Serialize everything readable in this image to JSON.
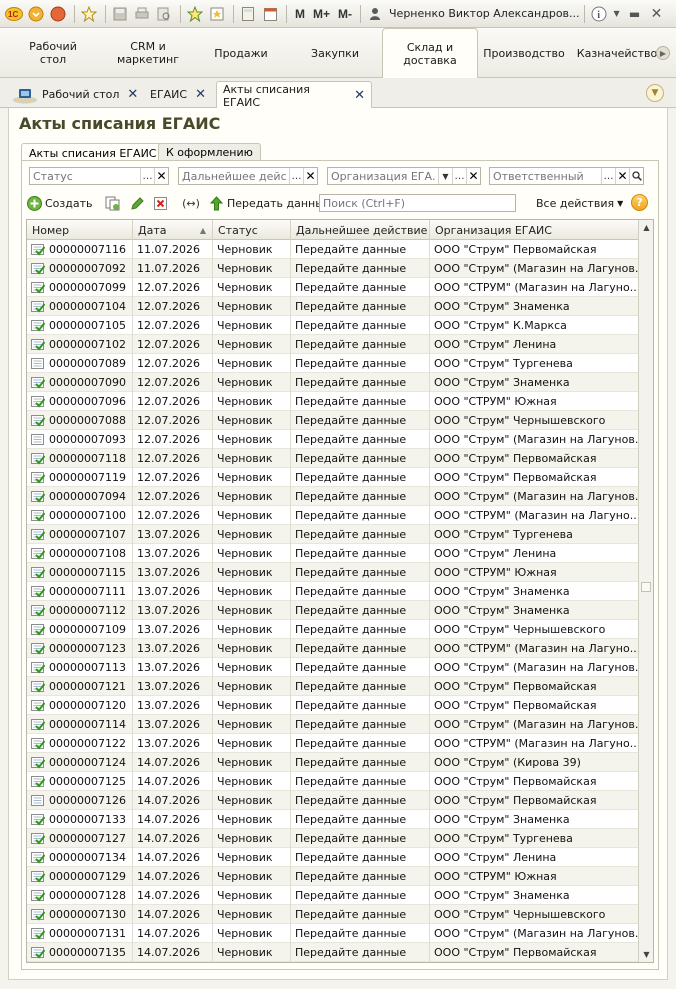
{
  "toolbar": {
    "user": "Черненко Виктор Александров...",
    "m": "M",
    "m_plus": "M+",
    "m_minus": "M-"
  },
  "sections": [
    "Рабочий\nстол",
    "CRM и\nмаркетинг",
    "Продажи",
    "Закупки",
    "Склад и\nдоставка",
    "Производство",
    "Казначейство"
  ],
  "window_tabs": [
    "Рабочий стол",
    "ЕГАИС",
    "Акты списания ЕГАИС"
  ],
  "form": {
    "title": "Акты списания ЕГАИС",
    "tabs": [
      "Акты списания ЕГАИС",
      "К оформлению"
    ]
  },
  "filters": {
    "status": "Статус",
    "next_action": "Дальнейшее дейст...",
    "organization": "Организация ЕГА...",
    "responsible": "Ответственный"
  },
  "commands": {
    "create": "Создать",
    "transfer": "Передать данные",
    "search_placeholder": "Поиск (Ctrl+F)",
    "all_actions": "Все действия",
    "help": "?"
  },
  "table": {
    "columns": [
      "Номер",
      "Дата",
      "Статус",
      "Дальнейшее действие",
      "Организация ЕГАИС"
    ],
    "rows": [
      [
        "00000007116",
        "11.07.2026",
        "Черновик",
        "Передайте данные",
        "ООО \"Струм\" Первомайская",
        "check"
      ],
      [
        "00000007092",
        "11.07.2026",
        "Черновик",
        "Передайте данные",
        "ООО \"Струм\" (Магазин на Лагунов...",
        "check"
      ],
      [
        "00000007099",
        "12.07.2026",
        "Черновик",
        "Передайте данные",
        "ООО \"СТРУМ\" (Магазин на Лагуно...",
        "check"
      ],
      [
        "00000007104",
        "12.07.2026",
        "Черновик",
        "Передайте данные",
        "ООО \"Струм\" Знаменка",
        "check"
      ],
      [
        "00000007105",
        "12.07.2026",
        "Черновик",
        "Передайте данные",
        "ООО \"Струм\" К.Маркса",
        "check"
      ],
      [
        "00000007102",
        "12.07.2026",
        "Черновик",
        "Передайте данные",
        "ООО \"Струм\" Ленина",
        "check"
      ],
      [
        "00000007089",
        "12.07.2026",
        "Черновик",
        "Передайте данные",
        "ООО \"Струм\" Тургенева",
        "plain"
      ],
      [
        "00000007090",
        "12.07.2026",
        "Черновик",
        "Передайте данные",
        "ООО \"Струм\" Знаменка",
        "check"
      ],
      [
        "00000007096",
        "12.07.2026",
        "Черновик",
        "Передайте данные",
        "ООО \"СТРУМ\" Южная",
        "check"
      ],
      [
        "00000007088",
        "12.07.2026",
        "Черновик",
        "Передайте данные",
        "ООО \"Струм\" Чернышевского",
        "check"
      ],
      [
        "00000007093",
        "12.07.2026",
        "Черновик",
        "Передайте данные",
        "ООО \"Струм\" (Магазин на Лагунов...",
        "plain"
      ],
      [
        "00000007118",
        "12.07.2026",
        "Черновик",
        "Передайте данные",
        "ООО \"Струм\" Первомайская",
        "check"
      ],
      [
        "00000007119",
        "12.07.2026",
        "Черновик",
        "Передайте данные",
        "ООО \"Струм\" Первомайская",
        "check"
      ],
      [
        "00000007094",
        "12.07.2026",
        "Черновик",
        "Передайте данные",
        "ООО \"Струм\" (Магазин на Лагунов...",
        "check"
      ],
      [
        "00000007100",
        "12.07.2026",
        "Черновик",
        "Передайте данные",
        "ООО \"СТРУМ\" (Магазин на Лагуно...",
        "check"
      ],
      [
        "00000007107",
        "13.07.2026",
        "Черновик",
        "Передайте данные",
        "ООО \"Струм\" Тургенева",
        "check"
      ],
      [
        "00000007108",
        "13.07.2026",
        "Черновик",
        "Передайте данные",
        "ООО \"Струм\" Ленина",
        "check"
      ],
      [
        "00000007115",
        "13.07.2026",
        "Черновик",
        "Передайте данные",
        "ООО \"СТРУМ\" Южная",
        "check"
      ],
      [
        "00000007111",
        "13.07.2026",
        "Черновик",
        "Передайте данные",
        "ООО \"Струм\" Знаменка",
        "check"
      ],
      [
        "00000007112",
        "13.07.2026",
        "Черновик",
        "Передайте данные",
        "ООО \"Струм\" Знаменка",
        "check"
      ],
      [
        "00000007109",
        "13.07.2026",
        "Черновик",
        "Передайте данные",
        "ООО \"Струм\" Чернышевского",
        "check"
      ],
      [
        "00000007123",
        "13.07.2026",
        "Черновик",
        "Передайте данные",
        "ООО \"СТРУМ\" (Магазин на Лагуно...",
        "check"
      ],
      [
        "00000007113",
        "13.07.2026",
        "Черновик",
        "Передайте данные",
        "ООО \"Струм\" (Магазин на Лагунов...",
        "check"
      ],
      [
        "00000007121",
        "13.07.2026",
        "Черновик",
        "Передайте данные",
        "ООО \"Струм\" Первомайская",
        "check"
      ],
      [
        "00000007120",
        "13.07.2026",
        "Черновик",
        "Передайте данные",
        "ООО \"Струм\" Первомайская",
        "check"
      ],
      [
        "00000007114",
        "13.07.2026",
        "Черновик",
        "Передайте данные",
        "ООО \"Струм\" (Магазин на Лагунов...",
        "check"
      ],
      [
        "00000007122",
        "13.07.2026",
        "Черновик",
        "Передайте данные",
        "ООО \"СТРУМ\" (Магазин на Лагуно...",
        "check"
      ],
      [
        "00000007124",
        "14.07.2026",
        "Черновик",
        "Передайте данные",
        "ООО \"Струм\" (Кирова 39)",
        "check"
      ],
      [
        "00000007125",
        "14.07.2026",
        "Черновик",
        "Передайте данные",
        "ООО \"Струм\" Первомайская",
        "check"
      ],
      [
        "00000007126",
        "14.07.2026",
        "Черновик",
        "Передайте данные",
        "ООО \"Струм\" Первомайская",
        "plain"
      ],
      [
        "00000007133",
        "14.07.2026",
        "Черновик",
        "Передайте данные",
        "ООО \"Струм\" Знаменка",
        "check"
      ],
      [
        "00000007127",
        "14.07.2026",
        "Черновик",
        "Передайте данные",
        "ООО \"Струм\" Тургенева",
        "check"
      ],
      [
        "00000007134",
        "14.07.2026",
        "Черновик",
        "Передайте данные",
        "ООО \"Струм\" Ленина",
        "check"
      ],
      [
        "00000007129",
        "14.07.2026",
        "Черновик",
        "Передайте данные",
        "ООО \"СТРУМ\" Южная",
        "check"
      ],
      [
        "00000007128",
        "14.07.2026",
        "Черновик",
        "Передайте данные",
        "ООО \"Струм\" Знаменка",
        "check"
      ],
      [
        "00000007130",
        "14.07.2026",
        "Черновик",
        "Передайте данные",
        "ООО \"Струм\" Чернышевского",
        "check"
      ],
      [
        "00000007131",
        "14.07.2026",
        "Черновик",
        "Передайте данные",
        "ООО \"Струм\" (Магазин на Лагунов...",
        "check"
      ],
      [
        "00000007135",
        "14.07.2026",
        "Черновик",
        "Передайте данные",
        "ООО \"Струм\" Первомайская",
        "check"
      ]
    ]
  }
}
